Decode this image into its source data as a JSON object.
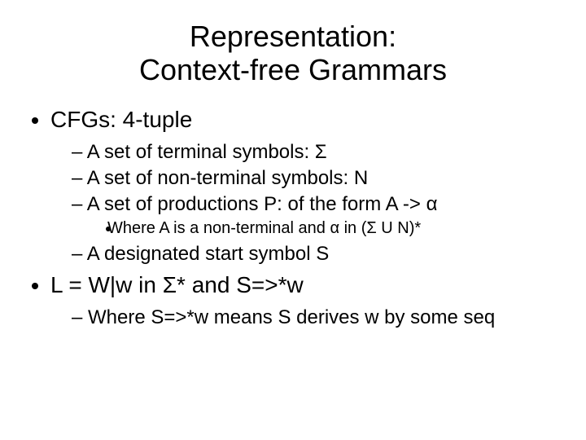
{
  "title_line1": "Representation:",
  "title_line2": "Context-free Grammars",
  "bullets": {
    "b1": "CFGs: 4-tuple",
    "b1_sub": {
      "s1": "A set of terminal symbols: Σ",
      "s2": "A set of non-terminal symbols: N",
      "s3": "A set of productions P: of the form A -> α",
      "s3_sub1": "Where A is a non-terminal and α in (Σ U N)*",
      "s4": "A designated start symbol S"
    },
    "b2": "L = W|w in Σ* and S=>*w",
    "b2_sub": {
      "s1": "Where S=>*w means S derives w by some seq"
    }
  }
}
